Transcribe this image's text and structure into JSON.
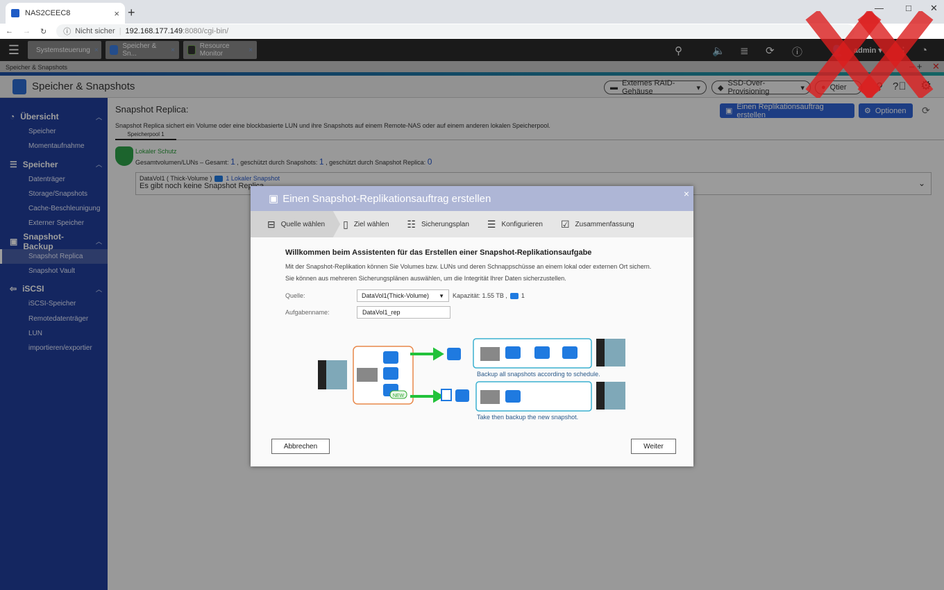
{
  "browser": {
    "tab_title": "NAS2CEEC8",
    "security": "Nicht sicher",
    "url_host": "192.168.177.149",
    "url_rest": ":8080/cgi-bin/"
  },
  "qts": {
    "apps": [
      {
        "label": "Systemsteuerung"
      },
      {
        "label": "Speicher & Sn..."
      },
      {
        "label": "Resource Monitor"
      }
    ],
    "user": "admin ▾"
  },
  "app": {
    "window_label": "Speicher & Snapshots",
    "title": "Speicher & Snapshots",
    "toolbar": {
      "raid": "Externes RAID-Gehäuse",
      "ssd": "SSD-Over-Provisioning",
      "qtier": "Qtier"
    }
  },
  "sidebar": {
    "groups": [
      {
        "label": "Übersicht",
        "items": [
          "Speicher",
          "Momentaufnahme"
        ]
      },
      {
        "label": "Speicher",
        "items": [
          "Datenträger",
          "Storage/Snapshots",
          "Cache-Beschleunigung",
          "Externer Speicher"
        ]
      },
      {
        "label": "Snapshot-Backup",
        "items": [
          "Snapshot Replica",
          "Snapshot Vault"
        ]
      },
      {
        "label": "iSCSI",
        "items": [
          "iSCSI-Speicher",
          "Remotedatenträger",
          "LUN importieren/exportier"
        ]
      }
    ],
    "active": "Snapshot Replica"
  },
  "page": {
    "title": "Snapshot Replica:",
    "create_button": "Einen Replikationsauftrag erstellen",
    "options_button": "Optionen",
    "description": "Snapshot Replica sichert ein Volume oder eine blockbasierte LUN und ihre Snapshots auf einem Remote-NAS oder auf einem anderen lokalen Speicherpool.",
    "pool_tab": "Speicherpool  1",
    "protection_title": "Lokaler Schutz",
    "stats": {
      "total_label": "Gesamtvolumen/LUNs – Gesamt:",
      "total": "1",
      "snap_label": ", geschützt durch Snapshots:",
      "snap": "1",
      "replica_label": ", geschützt durch Snapshot Replica:",
      "replica": "0"
    },
    "volume": {
      "name": "DataVol1 ( Thick-Volume )",
      "snapshots": "1 Lokaler Snapshot",
      "status": "Es gibt noch keine Snapshot Replica"
    }
  },
  "modal": {
    "title": "Einen Snapshot-Replikationsauftrag erstellen",
    "steps": [
      {
        "label": "Quelle wählen",
        "icon": "drive-icon"
      },
      {
        "label": "Ziel wählen",
        "icon": "cylinder-icon"
      },
      {
        "label": "Sicherungsplan",
        "icon": "schedule-list-icon"
      },
      {
        "label": "Konfigurieren",
        "icon": "list-icon"
      },
      {
        "label": "Zusammenfassung",
        "icon": "clipboard-icon"
      }
    ],
    "heading": "Willkommen beim Assistenten für das Erstellen einer Snapshot-Replikationsaufgabe",
    "description": "Mit der Snapshot-Replikation können Sie Volumes bzw. LUNs und deren Schnappschüsse an einem lokal oder externen Ort sichern. Sie können aus mehreren Sicherungsplänen auswählen, um die Integrität Ihrer Daten sicherzustellen.",
    "source_label": "Quelle:",
    "source_value": "DataVol1(Thick-Volume)",
    "capacity": "Kapazität: 1.55 TB ,",
    "snap_count": "1",
    "task_label": "Aufgabenname:",
    "task_value": "DataVol1_rep",
    "diagram": {
      "caption1": "Backup all snapshots according to schedule.",
      "caption2": "Take then backup the new snapshot.",
      "badge": "NEW"
    },
    "cancel": "Abbrechen",
    "next": "Weiter"
  },
  "colors": {
    "sidebar": "#213e9b",
    "primary_button": "#2f63d4",
    "modal_header": "#aeb6d6",
    "arrow": "#22c23a",
    "snapshot": "#1f7ae0"
  }
}
